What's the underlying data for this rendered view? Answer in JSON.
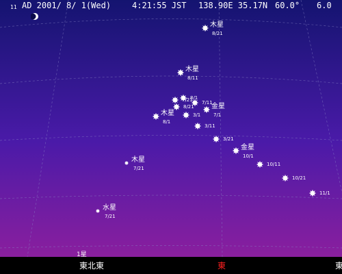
{
  "status_bar": {
    "moon_age": "11",
    "date_label": "AD 2001/ 8/ 1(Wed)",
    "time_label": "4:21:55 JST",
    "location_label": "138.90E 35.17N",
    "fov_label": "60.0°",
    "magnitude_limit": "6.0"
  },
  "colors": {
    "sky_top": "#141470",
    "sky_mid": "#4a1aa8",
    "sky_bottom": "#8a1f9e",
    "label_text": "#ffffff",
    "center_direction": "#ff2020",
    "background": "#000000"
  },
  "compass": {
    "left": "東北東",
    "center": "東",
    "right": "東"
  },
  "horizon_fragment": "1星",
  "objects": [
    {
      "name": "木星",
      "date": "8/21",
      "marker": "star-large"
    },
    {
      "name": "木星",
      "date": "8/11",
      "marker": "star-large"
    },
    {
      "name": "",
      "date": "8/1",
      "marker": "star-large"
    },
    {
      "name": "",
      "date": "7/21",
      "marker": "star-large"
    },
    {
      "name": "",
      "date": "7/11",
      "marker": "star-large"
    },
    {
      "name": "",
      "date": "8/21",
      "marker": "star-large"
    },
    {
      "name": "金星",
      "date": "7/1",
      "marker": "star-large"
    },
    {
      "name": "",
      "date": "3/1",
      "marker": "star-large"
    },
    {
      "name": "木星",
      "date": "8/1",
      "marker": "star-large"
    },
    {
      "name": "",
      "date": "3/11",
      "marker": "star-large"
    },
    {
      "name": "",
      "date": "3/21",
      "marker": "star-large"
    },
    {
      "name": "金星",
      "date": "10/1",
      "marker": "star-large"
    },
    {
      "name": "",
      "date": "10/11",
      "marker": "star-large"
    },
    {
      "name": "",
      "date": "10/21",
      "marker": "star-large"
    },
    {
      "name": "",
      "date": "11/1",
      "marker": "star-large"
    },
    {
      "name": "木星",
      "date": "7/21",
      "marker": "star-small"
    },
    {
      "name": "水星",
      "date": "7/21",
      "marker": "star-small"
    }
  ]
}
